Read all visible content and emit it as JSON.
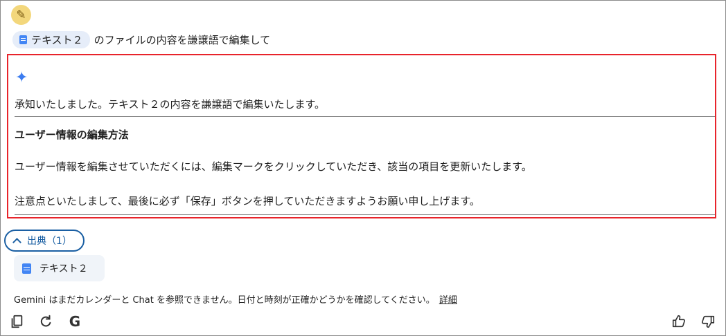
{
  "user": {
    "chip_label": "テキスト２",
    "prompt_text": "のファイルの内容を謙譲語で編集して"
  },
  "response": {
    "line1": "承知いたしました。テキスト２の内容を謙譲語で編集いたします。",
    "heading": "ユーザー情報の編集方法",
    "para1": "ユーザー情報を編集させていただくには、編集マークをクリックしていただき、該当の項目を更新いたします。",
    "para2": "注意点といたしまして、最後に必ず「保存」ボタンを押していただきますようお願い申し上げます。"
  },
  "sources": {
    "toggle_label": "出典（1）",
    "items": [
      {
        "label": "テキスト２"
      }
    ]
  },
  "disclaimer": {
    "text": "Gemini はまだカレンダーと Chat を参照できません。日付と時刻が正確かどうかを確認してください。",
    "link": "詳細"
  },
  "actions": {
    "g_label": "G"
  },
  "icons": [
    "avatar-icon",
    "doc-icon",
    "sparkle-icon",
    "chevron-up-icon",
    "copy-icon",
    "refresh-icon",
    "google-icon",
    "thumbs-up-icon",
    "thumbs-down-icon"
  ],
  "colors": {
    "accent": "#1a5fa3",
    "highlight_border": "#e8242b",
    "doc_blue": "#4285f4",
    "sparkle": "#3b7cf0"
  }
}
